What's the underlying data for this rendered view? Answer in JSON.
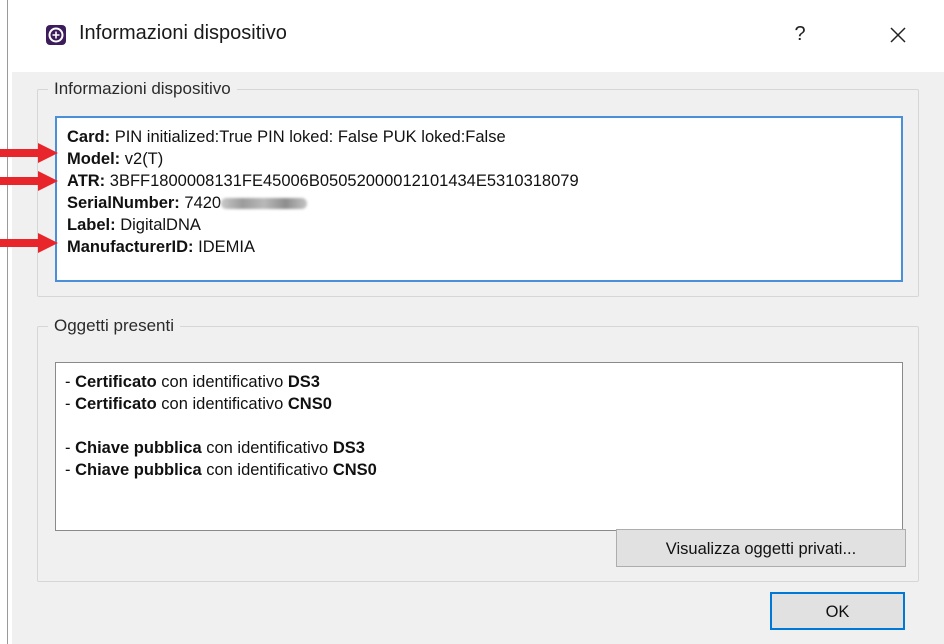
{
  "window": {
    "title": "Informazioni dispositivo",
    "help_label": "?",
    "icons": {
      "app": "smartcard-app-icon",
      "close": "close-icon"
    }
  },
  "device_group": {
    "title": "Informazioni dispositivo",
    "lines": [
      {
        "label": "Card:",
        "value": "PIN initialized:True PIN loked: False PUK loked:False"
      },
      {
        "label": "Model:",
        "value": "v2(T)"
      },
      {
        "label": "ATR:",
        "value": "3BFF1800008131FE45006B05052000012101434E5310318079"
      },
      {
        "label": "SerialNumber:",
        "value": "7420"
      },
      {
        "label": "Label:",
        "value": "DigitalDNA"
      },
      {
        "label": "ManufacturerID:",
        "value": "IDEMIA"
      }
    ],
    "annotation_color": "#e8252b"
  },
  "objects_group": {
    "title": "Oggetti presenti",
    "items": [
      {
        "prefix": "- ",
        "type": "Certificato",
        "middle": "con identificativo",
        "id": "DS3"
      },
      {
        "prefix": "- ",
        "type": "Certificato",
        "middle": "con identificativo",
        "id": "CNS0"
      },
      {
        "prefix": "- ",
        "type": "Chiave pubblica",
        "middle": "con identificativo",
        "id": "DS3"
      },
      {
        "prefix": "- ",
        "type": "Chiave pubblica",
        "middle": "con identificativo",
        "id": "CNS0"
      }
    ]
  },
  "buttons": {
    "private_label": "Visualizza oggetti privati...",
    "ok_label": "OK"
  },
  "colors": {
    "focus_border": "#4a90d9",
    "ok_border": "#0078d7",
    "background": "#f0f0f0"
  }
}
